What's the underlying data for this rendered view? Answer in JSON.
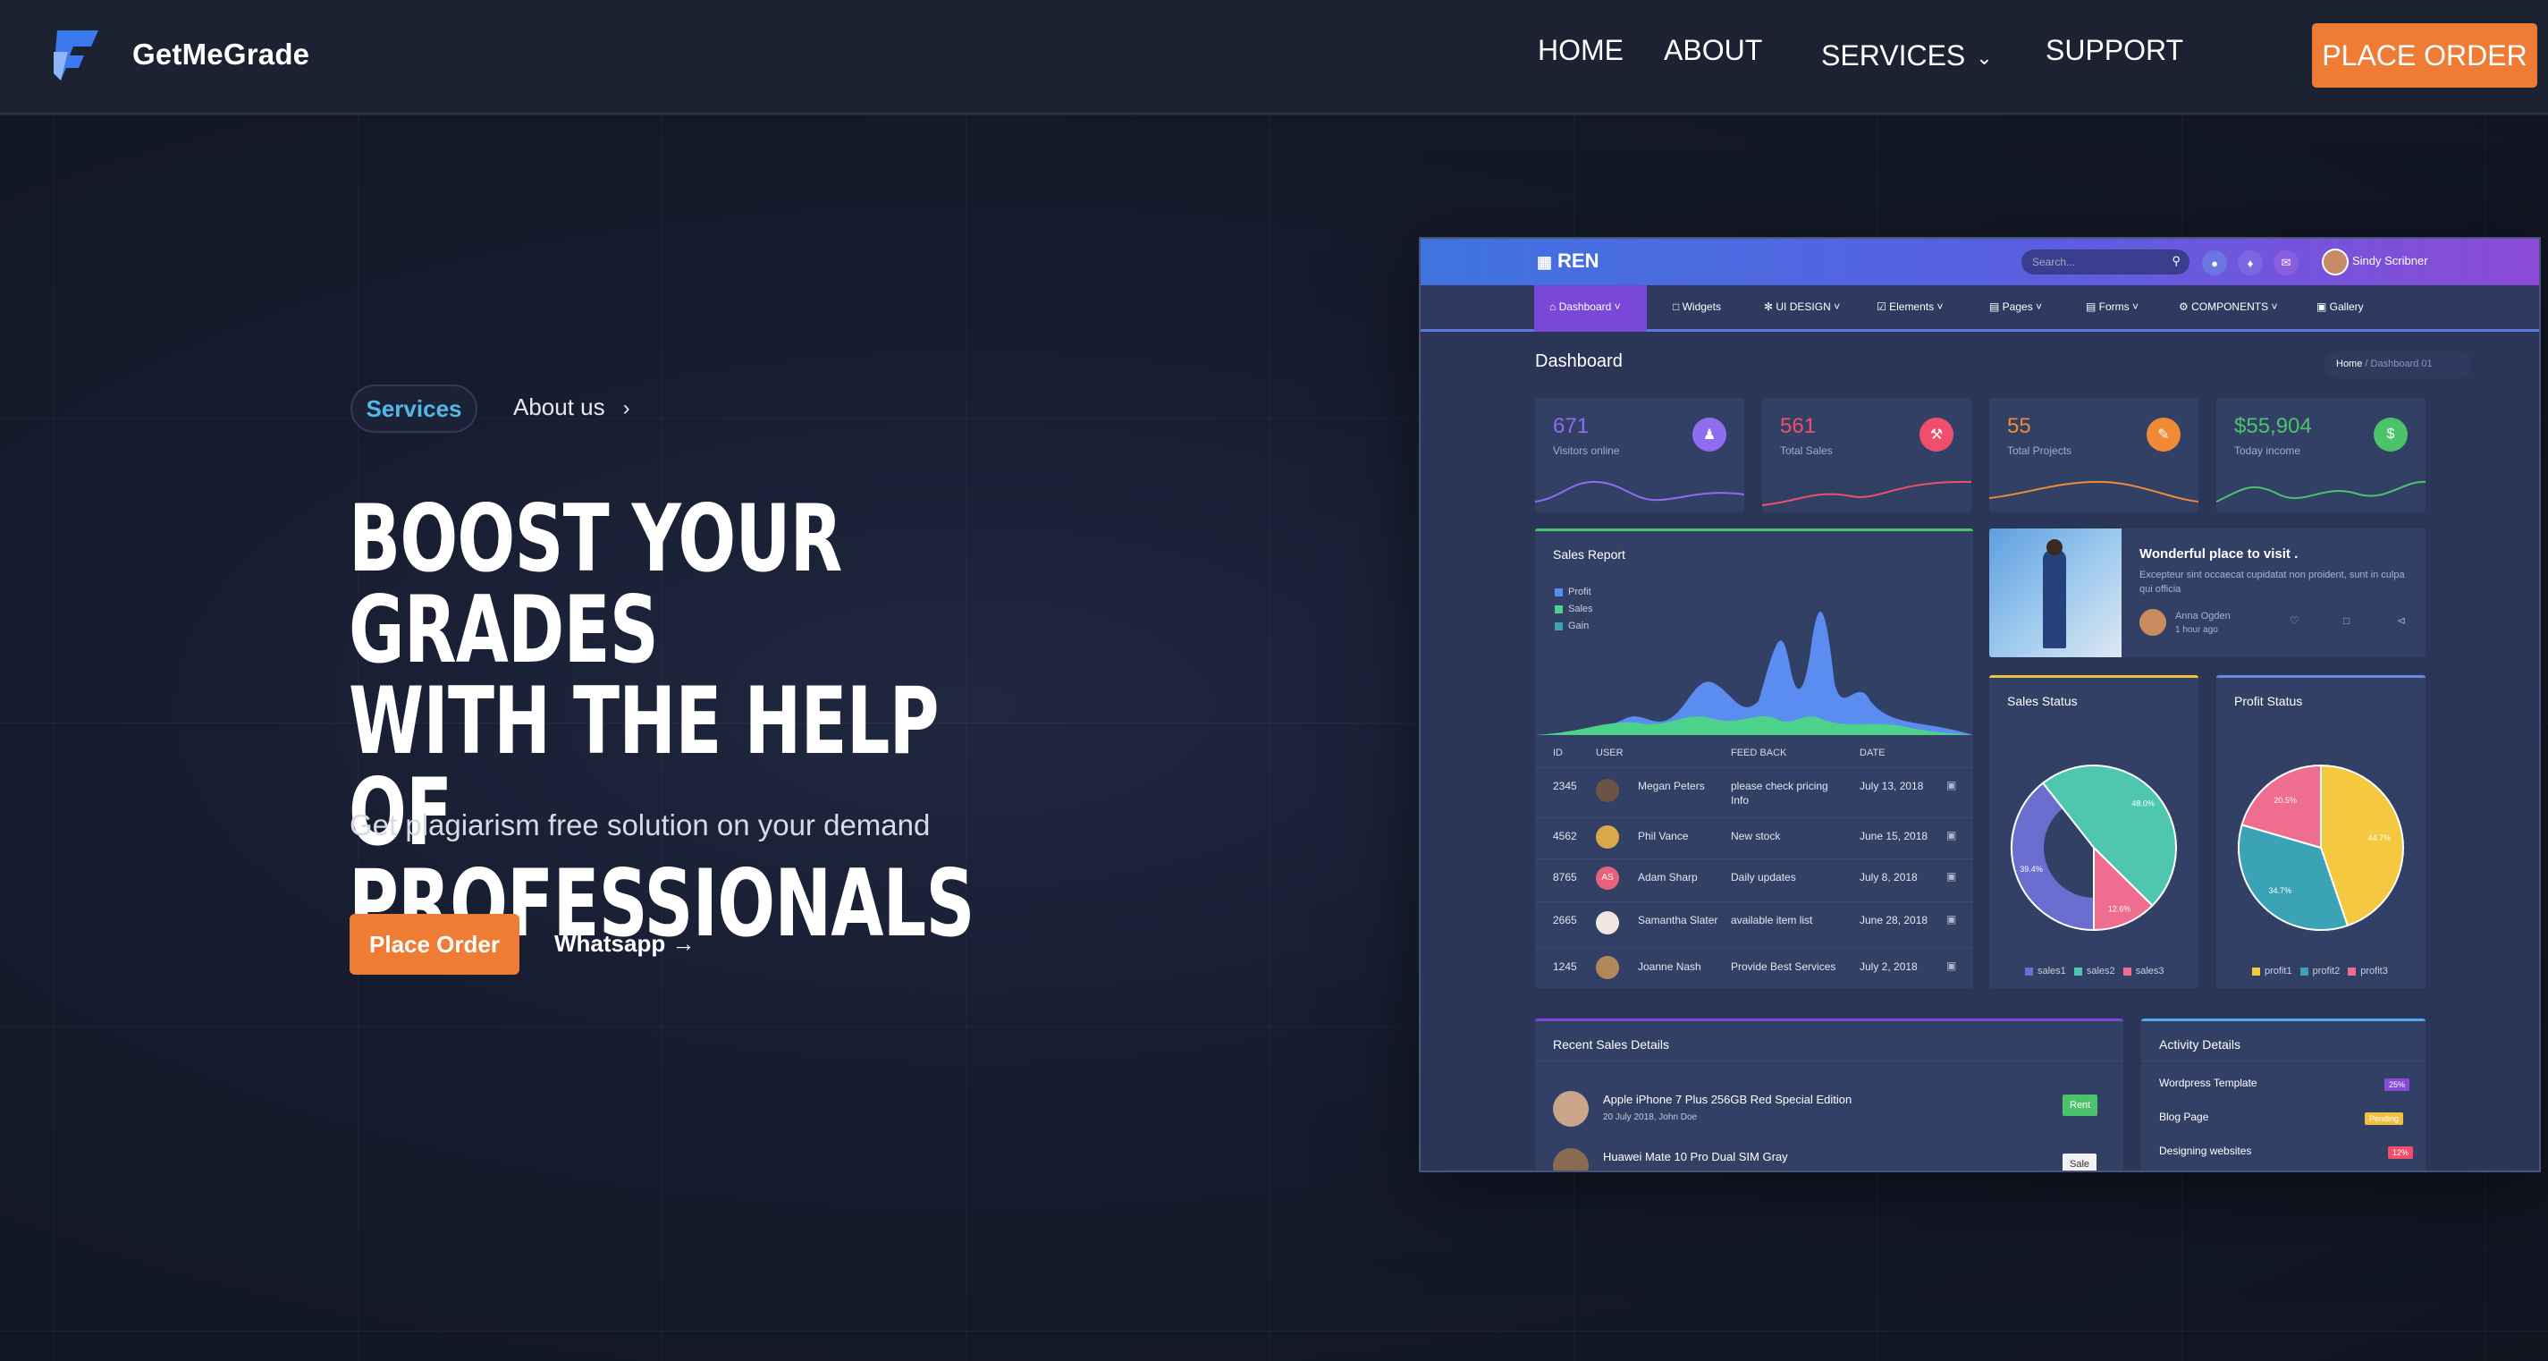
{
  "nav": {
    "brand": "GetMeGrade",
    "links": {
      "home": "HOME",
      "about": "ABOUT",
      "services": "SERVICES",
      "support": "SUPPORT"
    },
    "cta": "PLACE ORDER"
  },
  "hero": {
    "pill": "Services",
    "about_link": "About us",
    "headline": [
      "BOOST YOUR GRADES",
      "WITH THE HELP OF",
      "PROFESSIONALS"
    ],
    "subtitle": "Get plagiarism free solution on your demand",
    "primary_button": "Place Order",
    "secondary_button": "Whatsapp →"
  },
  "mock": {
    "brand": "REN",
    "search_placeholder": "Search...",
    "user": "Sindy Scribner",
    "menu": [
      "Dashboard",
      "Widgets",
      "UI DESIGN",
      "Elements",
      "Pages",
      "Forms",
      "COMPONENTS",
      "Gallery"
    ],
    "page_title": "Dashboard",
    "breadcrumb": {
      "home": "Home",
      "current": "Dashboard 01"
    },
    "stats": [
      {
        "value": "671",
        "label": "Visitors online",
        "color": "#8f6cf0",
        "icon": "users-icon"
      },
      {
        "value": "561",
        "label": "Total Sales",
        "color": "#ef4f6c",
        "icon": "cart-icon"
      },
      {
        "value": "55",
        "label": "Total Projects",
        "color": "#f08a36",
        "icon": "edit-icon"
      },
      {
        "value": "$55,904",
        "label": "Today income",
        "color": "#4cc36a",
        "icon": "dollar-icon"
      }
    ],
    "sales_report": {
      "title": "Sales Report",
      "legend": [
        "Profit",
        "Sales",
        "Gain"
      ]
    },
    "table": {
      "headers": [
        "ID",
        "USER",
        "FEED BACK",
        "DATE"
      ],
      "rows": [
        {
          "id": "2345",
          "user": "Megan Peters",
          "feedback": "please check pricing Info",
          "date": "July 13, 2018"
        },
        {
          "id": "4562",
          "user": "Phil Vance",
          "feedback": "New stock",
          "date": "June 15, 2018"
        },
        {
          "id": "8765",
          "user": "Adam Sharp",
          "feedback": "Daily updates",
          "date": "July 8, 2018",
          "initials": "AS"
        },
        {
          "id": "2665",
          "user": "Samantha Slater",
          "feedback": "available item list",
          "date": "June 28, 2018"
        },
        {
          "id": "1245",
          "user": "Joanne Nash",
          "feedback": "Provide Best Services",
          "date": "July 2, 2018"
        }
      ]
    },
    "promo": {
      "title": "Wonderful place to visit .",
      "text": "Excepteur sint occaecat cupidatat non proident, sunt in culpa qui officia",
      "author": "Anna Ogden",
      "time": "1 hour ago"
    },
    "sales_status": {
      "title": "Sales Status",
      "slices": [
        {
          "label": "sales1",
          "value": 39.4
        },
        {
          "label": "sales2",
          "value": 48.0
        },
        {
          "label": "sales3",
          "value": 12.6
        }
      ],
      "labels": [
        "12.6%",
        "48.0%",
        "39.4%"
      ]
    },
    "profit_status": {
      "title": "Profit Status",
      "slices": [
        {
          "label": "profit1",
          "value": 44.7
        },
        {
          "label": "profit2",
          "value": 34.7
        },
        {
          "label": "profit3",
          "value": 20.5
        }
      ],
      "labels": [
        "20.5%",
        "44.7%",
        "34.7%"
      ]
    },
    "recent_sales": {
      "title": "Recent Sales Details",
      "items": [
        {
          "name": "Apple iPhone 7 Plus 256GB Red Special Edition",
          "meta": "20 July 2018, John Doe",
          "tag": "Rent"
        },
        {
          "name": "Huawei Mate 10 Pro Dual SIM Gray",
          "meta": "",
          "tag": "Sale"
        }
      ]
    },
    "activity": {
      "title": "Activity Details",
      "items": [
        {
          "name": "Wordpress Template",
          "badge": "25%"
        },
        {
          "name": "Blog Page",
          "badge": "Pending"
        },
        {
          "name": "Designing websites",
          "badge": "12%"
        }
      ]
    }
  },
  "colors": {
    "accent": "#ef7c34",
    "pill_text": "#51b7e9",
    "background": "#161c2e"
  }
}
